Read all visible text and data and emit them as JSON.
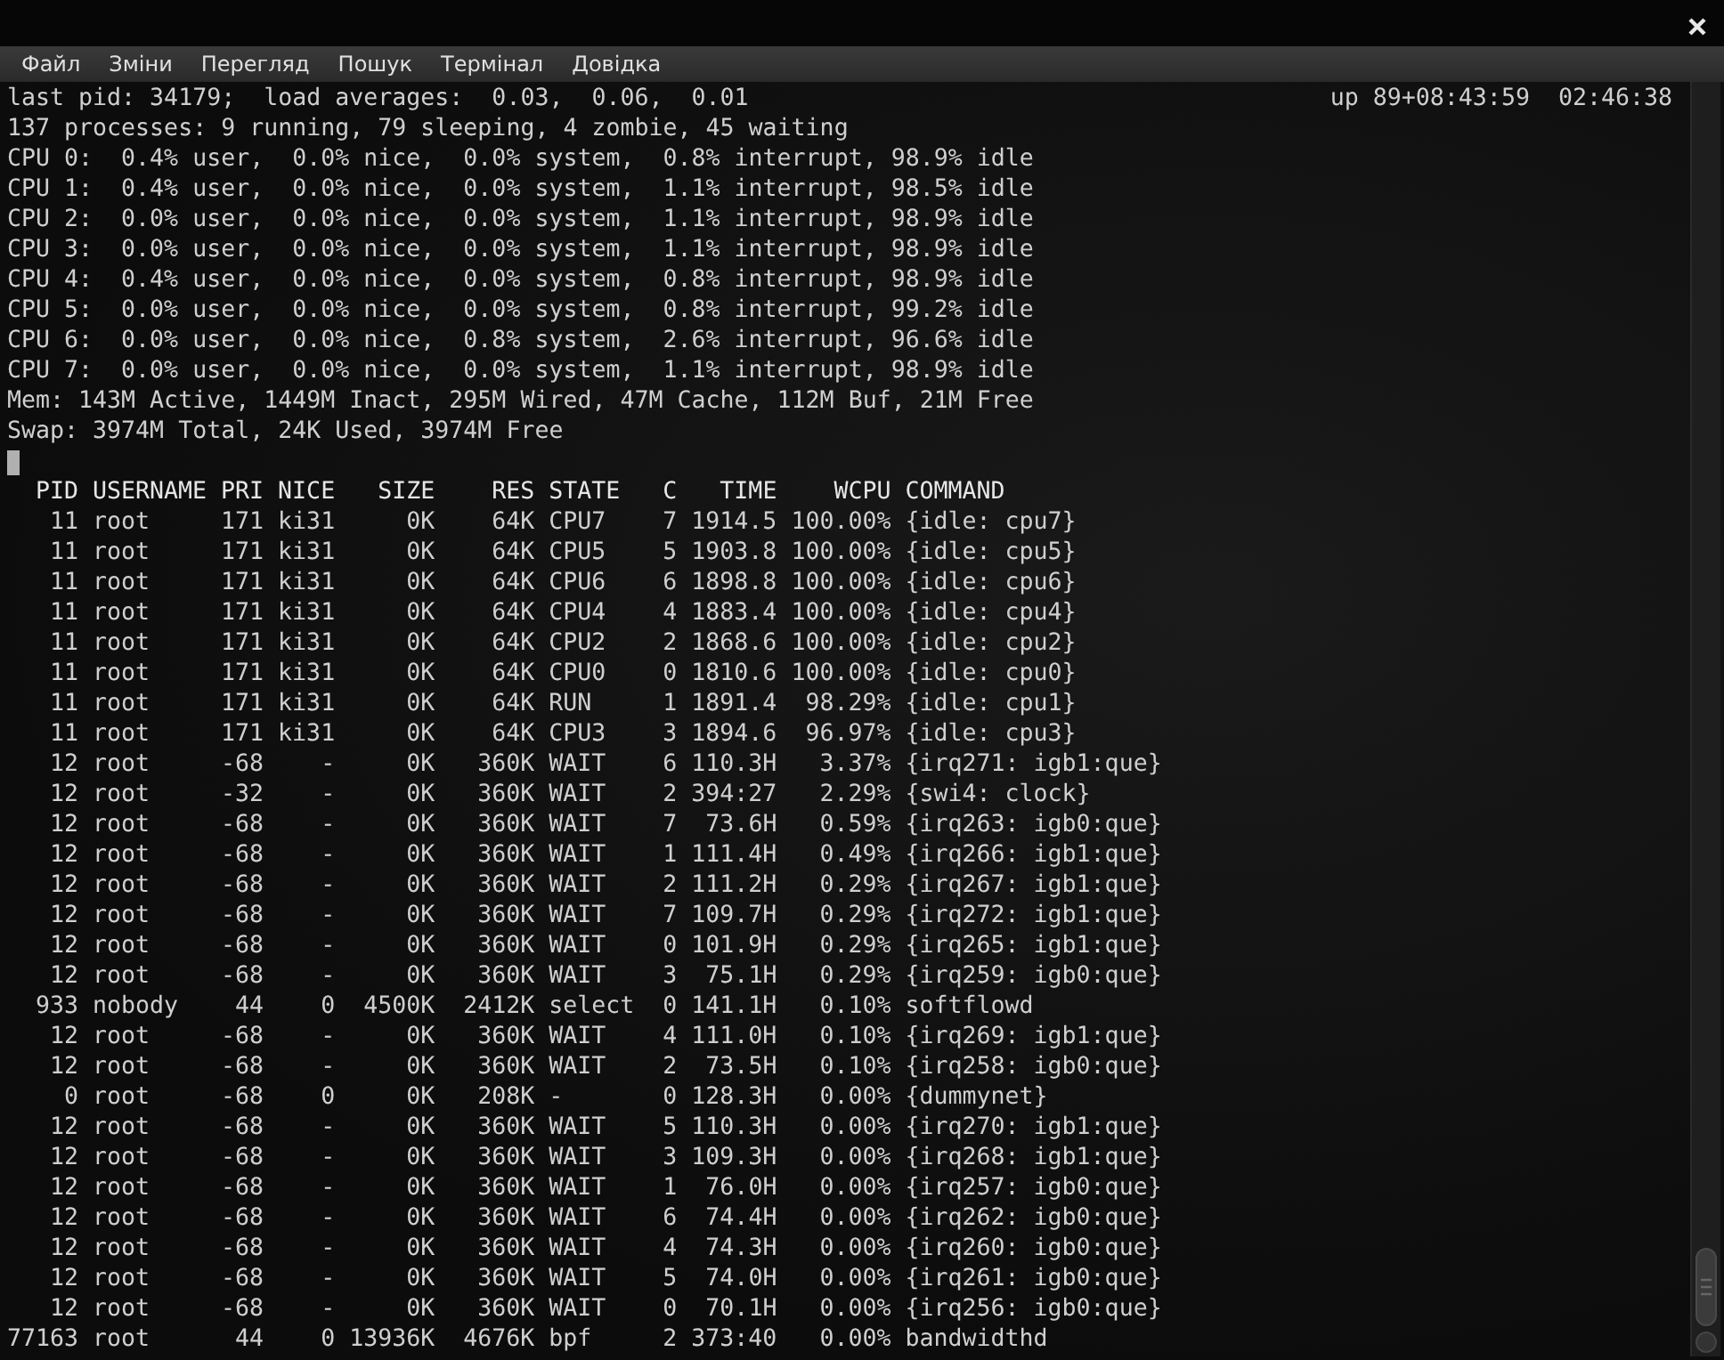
{
  "menu": [
    "Файл",
    "Зміни",
    "Перегляд",
    "Пошук",
    "Термінал",
    "Довідка"
  ],
  "summary": {
    "load_line": "last pid: 34179;  load averages:  0.03,  0.06,  0.01",
    "uptime": "up 89+08:43:59",
    "clock": "02:46:38"
  },
  "status_lines": [
    "137 processes: 9 running, 79 sleeping, 4 zombie, 45 waiting",
    "CPU 0:  0.4% user,  0.0% nice,  0.0% system,  0.8% interrupt, 98.9% idle",
    "CPU 1:  0.4% user,  0.0% nice,  0.0% system,  1.1% interrupt, 98.5% idle",
    "CPU 2:  0.0% user,  0.0% nice,  0.0% system,  1.1% interrupt, 98.9% idle",
    "CPU 3:  0.0% user,  0.0% nice,  0.0% system,  1.1% interrupt, 98.9% idle",
    "CPU 4:  0.4% user,  0.0% nice,  0.0% system,  0.8% interrupt, 98.9% idle",
    "CPU 5:  0.0% user,  0.0% nice,  0.0% system,  0.8% interrupt, 99.2% idle",
    "CPU 6:  0.0% user,  0.0% nice,  0.8% system,  2.6% interrupt, 96.6% idle",
    "CPU 7:  0.0% user,  0.0% nice,  0.0% system,  1.1% interrupt, 98.9% idle",
    "Mem: 143M Active, 1449M Inact, 295M Wired, 47M Cache, 112M Buf, 21M Free",
    "Swap: 3974M Total, 24K Used, 3974M Free"
  ],
  "table": {
    "columns": [
      "PID",
      "USERNAME",
      "PRI",
      "NICE",
      "SIZE",
      "RES",
      "STATE",
      "C",
      "TIME",
      "WCPU",
      "COMMAND"
    ],
    "rows": [
      [
        "11",
        "root",
        "171",
        "ki31",
        "0K",
        "64K",
        "CPU7",
        "7",
        "1914.5",
        "100.00%",
        "{idle: cpu7}"
      ],
      [
        "11",
        "root",
        "171",
        "ki31",
        "0K",
        "64K",
        "CPU5",
        "5",
        "1903.8",
        "100.00%",
        "{idle: cpu5}"
      ],
      [
        "11",
        "root",
        "171",
        "ki31",
        "0K",
        "64K",
        "CPU6",
        "6",
        "1898.8",
        "100.00%",
        "{idle: cpu6}"
      ],
      [
        "11",
        "root",
        "171",
        "ki31",
        "0K",
        "64K",
        "CPU4",
        "4",
        "1883.4",
        "100.00%",
        "{idle: cpu4}"
      ],
      [
        "11",
        "root",
        "171",
        "ki31",
        "0K",
        "64K",
        "CPU2",
        "2",
        "1868.6",
        "100.00%",
        "{idle: cpu2}"
      ],
      [
        "11",
        "root",
        "171",
        "ki31",
        "0K",
        "64K",
        "CPU0",
        "0",
        "1810.6",
        "100.00%",
        "{idle: cpu0}"
      ],
      [
        "11",
        "root",
        "171",
        "ki31",
        "0K",
        "64K",
        "RUN",
        "1",
        "1891.4",
        "98.29%",
        "{idle: cpu1}"
      ],
      [
        "11",
        "root",
        "171",
        "ki31",
        "0K",
        "64K",
        "CPU3",
        "3",
        "1894.6",
        "96.97%",
        "{idle: cpu3}"
      ],
      [
        "12",
        "root",
        "-68",
        "-",
        "0K",
        "360K",
        "WAIT",
        "6",
        "110.3H",
        "3.37%",
        "{irq271: igb1:que}"
      ],
      [
        "12",
        "root",
        "-32",
        "-",
        "0K",
        "360K",
        "WAIT",
        "2",
        "394:27",
        "2.29%",
        "{swi4: clock}"
      ],
      [
        "12",
        "root",
        "-68",
        "-",
        "0K",
        "360K",
        "WAIT",
        "7",
        "73.6H",
        "0.59%",
        "{irq263: igb0:que}"
      ],
      [
        "12",
        "root",
        "-68",
        "-",
        "0K",
        "360K",
        "WAIT",
        "1",
        "111.4H",
        "0.49%",
        "{irq266: igb1:que}"
      ],
      [
        "12",
        "root",
        "-68",
        "-",
        "0K",
        "360K",
        "WAIT",
        "2",
        "111.2H",
        "0.29%",
        "{irq267: igb1:que}"
      ],
      [
        "12",
        "root",
        "-68",
        "-",
        "0K",
        "360K",
        "WAIT",
        "7",
        "109.7H",
        "0.29%",
        "{irq272: igb1:que}"
      ],
      [
        "12",
        "root",
        "-68",
        "-",
        "0K",
        "360K",
        "WAIT",
        "0",
        "101.9H",
        "0.29%",
        "{irq265: igb1:que}"
      ],
      [
        "12",
        "root",
        "-68",
        "-",
        "0K",
        "360K",
        "WAIT",
        "3",
        "75.1H",
        "0.29%",
        "{irq259: igb0:que}"
      ],
      [
        "933",
        "nobody",
        "44",
        "0",
        "4500K",
        "2412K",
        "select",
        "0",
        "141.1H",
        "0.10%",
        "softflowd"
      ],
      [
        "12",
        "root",
        "-68",
        "-",
        "0K",
        "360K",
        "WAIT",
        "4",
        "111.0H",
        "0.10%",
        "{irq269: igb1:que}"
      ],
      [
        "12",
        "root",
        "-68",
        "-",
        "0K",
        "360K",
        "WAIT",
        "2",
        "73.5H",
        "0.10%",
        "{irq258: igb0:que}"
      ],
      [
        "0",
        "root",
        "-68",
        "0",
        "0K",
        "208K",
        "-",
        "0",
        "128.3H",
        "0.00%",
        "{dummynet}"
      ],
      [
        "12",
        "root",
        "-68",
        "-",
        "0K",
        "360K",
        "WAIT",
        "5",
        "110.3H",
        "0.00%",
        "{irq270: igb1:que}"
      ],
      [
        "12",
        "root",
        "-68",
        "-",
        "0K",
        "360K",
        "WAIT",
        "3",
        "109.3H",
        "0.00%",
        "{irq268: igb1:que}"
      ],
      [
        "12",
        "root",
        "-68",
        "-",
        "0K",
        "360K",
        "WAIT",
        "1",
        "76.0H",
        "0.00%",
        "{irq257: igb0:que}"
      ],
      [
        "12",
        "root",
        "-68",
        "-",
        "0K",
        "360K",
        "WAIT",
        "6",
        "74.4H",
        "0.00%",
        "{irq262: igb0:que}"
      ],
      [
        "12",
        "root",
        "-68",
        "-",
        "0K",
        "360K",
        "WAIT",
        "4",
        "74.3H",
        "0.00%",
        "{irq260: igb0:que}"
      ],
      [
        "12",
        "root",
        "-68",
        "-",
        "0K",
        "360K",
        "WAIT",
        "5",
        "74.0H",
        "0.00%",
        "{irq261: igb0:que}"
      ],
      [
        "12",
        "root",
        "-68",
        "-",
        "0K",
        "360K",
        "WAIT",
        "0",
        "70.1H",
        "0.00%",
        "{irq256: igb0:que}"
      ],
      [
        "77163",
        "root",
        "44",
        "0",
        "13936K",
        "4676K",
        "bpf",
        "2",
        "373:40",
        "0.00%",
        "bandwidthd"
      ]
    ]
  }
}
